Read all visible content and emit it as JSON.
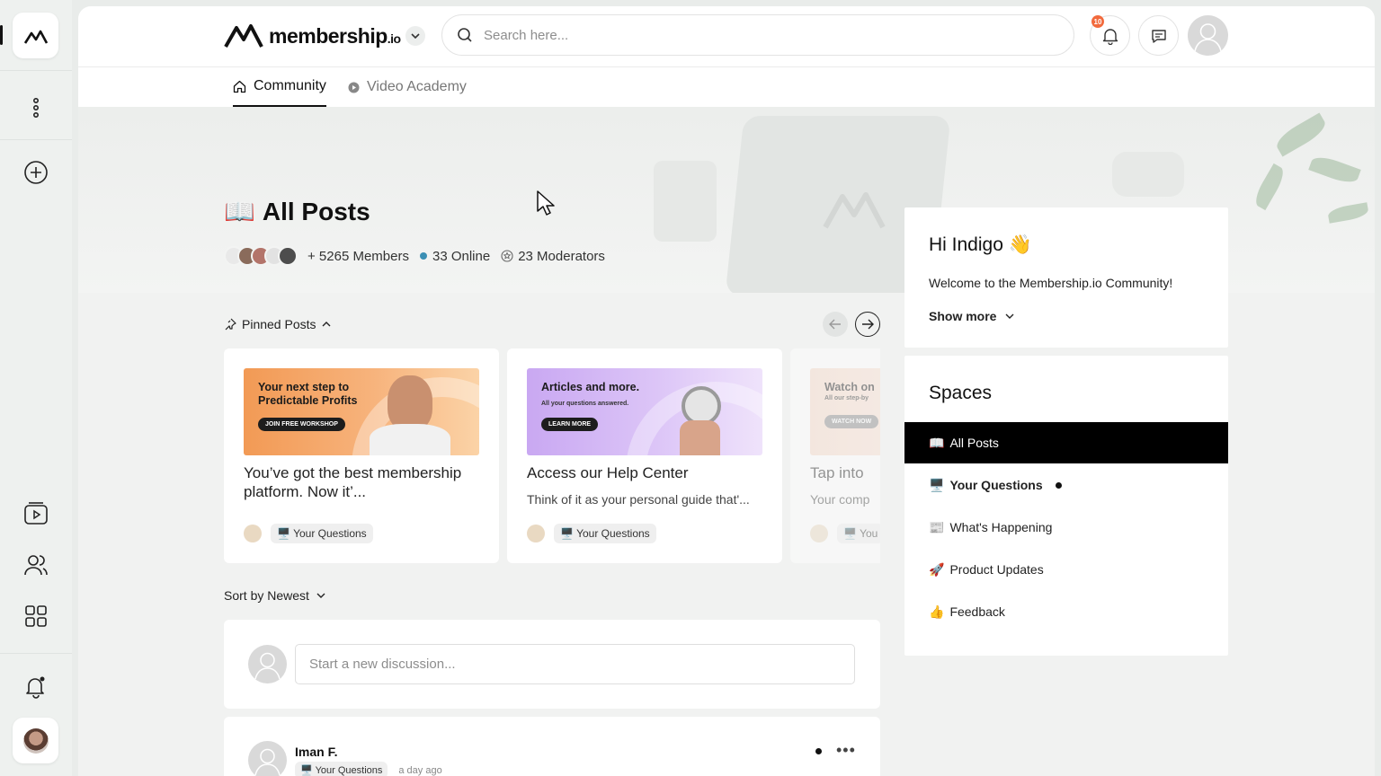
{
  "brand": {
    "name": "membership",
    "suffix": ".io"
  },
  "search": {
    "placeholder": "Search here..."
  },
  "notifications": {
    "count": "10"
  },
  "tabs": [
    {
      "label": "Community",
      "active": true
    },
    {
      "label": "Video Academy",
      "active": false
    }
  ],
  "hero": {
    "title": "All Posts",
    "members": "+ 5265 Members",
    "online": "33 Online",
    "moderators": "23 Moderators"
  },
  "pinned": {
    "label": "Pinned Posts",
    "cards": [
      {
        "banner_heading": "Your next step to Predictable Profits",
        "banner_sub": "",
        "banner_button": "JOIN FREE WORKSHOP",
        "title": "You’ve got the best membership platform. Now it’...",
        "description": "",
        "tag": "Your Questions",
        "banner_colors": [
          "#f29a55",
          "#fbd3a7"
        ]
      },
      {
        "banner_heading": "Articles and more.",
        "banner_sub": "All your questions answered.",
        "banner_button": "LEARN MORE",
        "title": "Access our Help Center",
        "description": "Think of it as your personal guide that'...",
        "tag": "Your Questions",
        "banner_colors": [
          "#c9a8f2",
          "#efe3fb"
        ]
      },
      {
        "banner_heading": "Watch on",
        "banner_sub": "All our step-by",
        "banner_button": "WATCH NOW",
        "title": "Tap into",
        "description": "Your comp",
        "tag": "You",
        "banner_colors": [
          "#f7d9c9",
          "#fbeee6"
        ]
      }
    ]
  },
  "sort": {
    "label": "Sort by Newest"
  },
  "composer": {
    "placeholder": "Start a new discussion..."
  },
  "post": {
    "author": "Iman F.",
    "tag": "Your Questions",
    "time": "a day ago"
  },
  "welcome": {
    "greeting": "Hi Indigo",
    "greeting_emoji": "👋",
    "message": "Welcome to the Membership.io Community!",
    "show_more": "Show more"
  },
  "spaces": {
    "title": "Spaces",
    "items": [
      {
        "emoji": "📖",
        "label": "All Posts",
        "active": true
      },
      {
        "emoji": "🖥️",
        "label": "Your Questions",
        "unread": true
      },
      {
        "emoji": "📰",
        "label": "What's Happening"
      },
      {
        "emoji": "🚀",
        "label": "Product Updates"
      },
      {
        "emoji": "👍",
        "label": "Feedback"
      }
    ]
  },
  "colors": {
    "accent": "#000000",
    "badge": "#f26a3d",
    "online": "#3b8fb4"
  }
}
